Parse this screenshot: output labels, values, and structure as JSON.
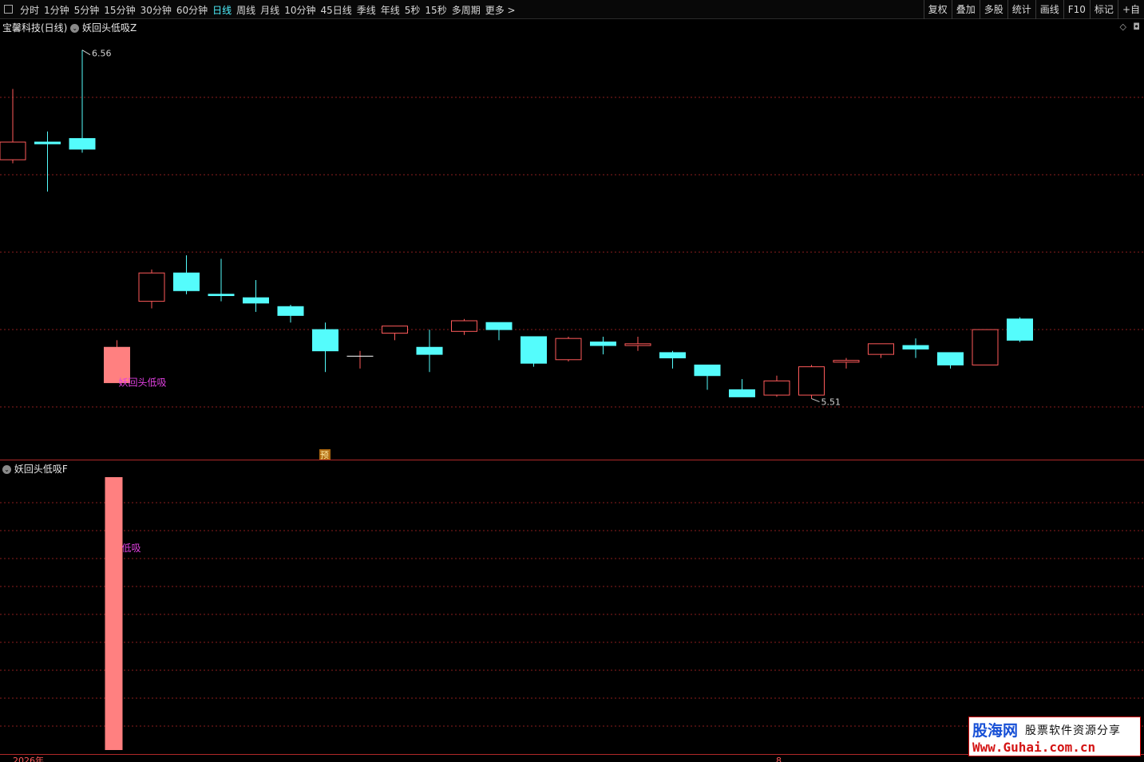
{
  "toolbar": {
    "periods": [
      "分时",
      "1分钟",
      "5分钟",
      "15分钟",
      "30分钟",
      "60分钟",
      "日线",
      "周线",
      "月线",
      "10分钟",
      "45日线",
      "季线",
      "年线",
      "5秒",
      "15秒",
      "多周期",
      "更多 >"
    ],
    "active_period": "日线",
    "tools": [
      "复权",
      "叠加",
      "多股",
      "统计",
      "画线",
      "F10",
      "标记",
      "+自"
    ]
  },
  "main_panel": {
    "stock_title": "宝馨科技(日线)",
    "indicator_name": "妖回头低吸Z",
    "high_label": "6.56",
    "low_label": "5.51",
    "signal_label": "妖回头低吸",
    "forecast_badge": "预"
  },
  "sub_panel": {
    "indicator_name": "妖回头低吸F",
    "signal_label": "低吸"
  },
  "footer": {
    "year_label": "2026年",
    "month_label": "8"
  },
  "watermark": {
    "brand": "股海网",
    "slogan": "股票软件资源分享",
    "url": "Www.Guhai.com.cn"
  },
  "colors": {
    "up": "#ff5a5a",
    "down": "#54fcfc",
    "signal": "#e040e0",
    "bar": "#ff8080",
    "grid": "#8b1e1e",
    "active": "#4ef2ff"
  },
  "chart_data": {
    "type": "candlestick",
    "price_range": [
      5.45,
      6.6
    ],
    "candles": [
      {
        "o": 6.25,
        "c": 6.3,
        "h": 6.45,
        "l": 6.24
      },
      {
        "o": 6.3,
        "c": 6.295,
        "h": 6.33,
        "l": 6.16
      },
      {
        "o": 6.31,
        "c": 6.28,
        "h": 6.56,
        "l": 6.27
      },
      {
        "o": 5.62,
        "c": 5.72,
        "h": 5.74,
        "l": 5.62
      },
      {
        "o": 5.85,
        "c": 5.93,
        "h": 5.94,
        "l": 5.83
      },
      {
        "o": 5.93,
        "c": 5.88,
        "h": 5.98,
        "l": 5.87
      },
      {
        "o": 5.87,
        "c": 5.866,
        "h": 5.97,
        "l": 5.85
      },
      {
        "o": 5.86,
        "c": 5.845,
        "h": 5.91,
        "l": 5.82
      },
      {
        "o": 5.835,
        "c": 5.81,
        "h": 5.84,
        "l": 5.79
      },
      {
        "o": 5.77,
        "c": 5.71,
        "h": 5.79,
        "l": 5.65
      },
      {
        "o": 5.695,
        "c": 5.695,
        "h": 5.71,
        "l": 5.66
      },
      {
        "o": 5.76,
        "c": 5.78,
        "h": 5.78,
        "l": 5.74
      },
      {
        "o": 5.72,
        "c": 5.7,
        "h": 5.77,
        "l": 5.65
      },
      {
        "o": 5.765,
        "c": 5.795,
        "h": 5.8,
        "l": 5.755
      },
      {
        "o": 5.79,
        "c": 5.77,
        "h": 5.79,
        "l": 5.74
      },
      {
        "o": 5.75,
        "c": 5.675,
        "h": 5.75,
        "l": 5.665
      },
      {
        "o": 5.685,
        "c": 5.745,
        "h": 5.75,
        "l": 5.68
      },
      {
        "o": 5.735,
        "c": 5.725,
        "h": 5.75,
        "l": 5.7
      },
      {
        "o": 5.725,
        "c": 5.73,
        "h": 5.75,
        "l": 5.71
      },
      {
        "o": 5.705,
        "c": 5.69,
        "h": 5.71,
        "l": 5.66
      },
      {
        "o": 5.67,
        "c": 5.64,
        "h": 5.67,
        "l": 5.6
      },
      {
        "o": 5.6,
        "c": 5.58,
        "h": 5.63,
        "l": 5.58
      },
      {
        "o": 5.585,
        "c": 5.625,
        "h": 5.64,
        "l": 5.58
      },
      {
        "o": 5.585,
        "c": 5.665,
        "h": 5.67,
        "l": 5.575
      },
      {
        "o": 5.678,
        "c": 5.683,
        "h": 5.69,
        "l": 5.66
      },
      {
        "o": 5.7,
        "c": 5.73,
        "h": 5.73,
        "l": 5.69
      },
      {
        "o": 5.725,
        "c": 5.715,
        "h": 5.745,
        "l": 5.69
      },
      {
        "o": 5.705,
        "c": 5.67,
        "h": 5.705,
        "l": 5.66
      },
      {
        "o": 5.67,
        "c": 5.77,
        "h": 5.77,
        "l": 5.67
      },
      {
        "o": 5.8,
        "c": 5.74,
        "h": 5.805,
        "l": 5.735
      }
    ],
    "signal_index": 3,
    "sub_bars": [
      {
        "index": 3,
        "value": 1
      }
    ]
  }
}
